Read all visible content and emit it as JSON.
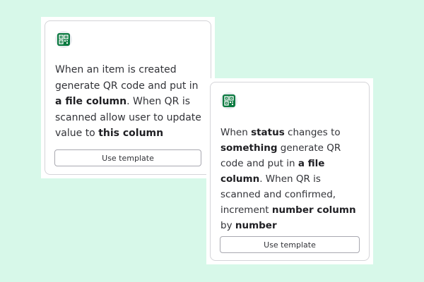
{
  "cards": [
    {
      "icon": "qr-code-icon",
      "segments": [
        {
          "text": "When an item is created generate QR code and put in ",
          "bold": false
        },
        {
          "text": "a file column",
          "bold": true
        },
        {
          "text": ". When QR is scanned allow user to update value to ",
          "bold": false
        },
        {
          "text": "this column",
          "bold": true
        }
      ],
      "button_label": "Use template"
    },
    {
      "icon": "qr-code-icon",
      "segments": [
        {
          "text": "When ",
          "bold": false
        },
        {
          "text": "status",
          "bold": true
        },
        {
          "text": " changes to ",
          "bold": false
        },
        {
          "text": "something",
          "bold": true
        },
        {
          "text": " generate QR code and put in ",
          "bold": false
        },
        {
          "text": "a file column",
          "bold": true
        },
        {
          "text": ". When QR is scanned and confirmed, increment ",
          "bold": false
        },
        {
          "text": "number column",
          "bold": true
        },
        {
          "text": " by ",
          "bold": false
        },
        {
          "text": "number",
          "bold": true
        }
      ],
      "button_label": "Use template"
    }
  ],
  "colors": {
    "background": "#d7f8e9",
    "icon_green": "#0b7a40",
    "text": "#323338"
  }
}
